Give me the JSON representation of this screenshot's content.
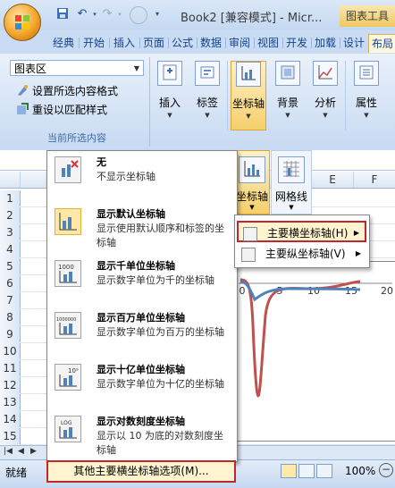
{
  "window": {
    "title": "Book2 [兼容模式] - Micr...",
    "context_tab": "图表工具"
  },
  "tabs": [
    "经典",
    "开始",
    "插入",
    "页面",
    "公式",
    "数据",
    "审阅",
    "视图",
    "开发",
    "加载",
    "设计",
    "布局"
  ],
  "ribbon": {
    "selection_group": {
      "dropdown_value": "图表区",
      "format_selection": "设置所选内容格式",
      "reset_style": "重设以匹配样式",
      "group_label": "当前所选内容"
    },
    "buttons": [
      {
        "label": "插入"
      },
      {
        "label": "标签"
      },
      {
        "label": "坐标轴"
      },
      {
        "label": "背景"
      },
      {
        "label": "分析"
      },
      {
        "label": "属性"
      }
    ]
  },
  "axes_button": {
    "label": "坐标轴"
  },
  "gridlines_button": {
    "label": "网格线"
  },
  "column_headers": [
    "E",
    "F"
  ],
  "rows": [
    "1",
    "2",
    "3",
    "4",
    "5",
    "6",
    "7",
    "8",
    "9",
    "10",
    "11",
    "12",
    "13",
    "14",
    "15"
  ],
  "gallery": {
    "items": [
      {
        "title": "无",
        "desc": "不显示坐标轴"
      },
      {
        "title": "显示默认坐标轴",
        "desc": "显示使用默认顺序和标签的坐标轴"
      },
      {
        "title": "显示千单位坐标轴",
        "desc": "显示数字单位为千的坐标轴"
      },
      {
        "title": "显示百万单位坐标轴",
        "desc": "显示数字单位为百万的坐标轴"
      },
      {
        "title": "显示十亿单位坐标轴",
        "desc": "显示数字单位为十亿的坐标轴"
      },
      {
        "title": "显示对数刻度坐标轴",
        "desc": "显示以 10 为底的对数刻度坐标轴"
      }
    ],
    "icon_labels": {
      "thousand": "1000",
      "million": "1000000",
      "billion": "10⁹",
      "log": "LOG"
    },
    "more_options": "其他主要横坐标轴选项(M)..."
  },
  "submenu": {
    "items": [
      {
        "label": "主要横坐标轴(H)"
      },
      {
        "label": "主要纵坐标轴(V)"
      }
    ]
  },
  "chart": {
    "x_tick_labels": [
      "0",
      "5",
      "10",
      "15",
      "20"
    ],
    "line_colors": [
      "#c0504d",
      "#4f81bd"
    ]
  },
  "status": {
    "ready": "就绪",
    "zoom": "100%"
  }
}
